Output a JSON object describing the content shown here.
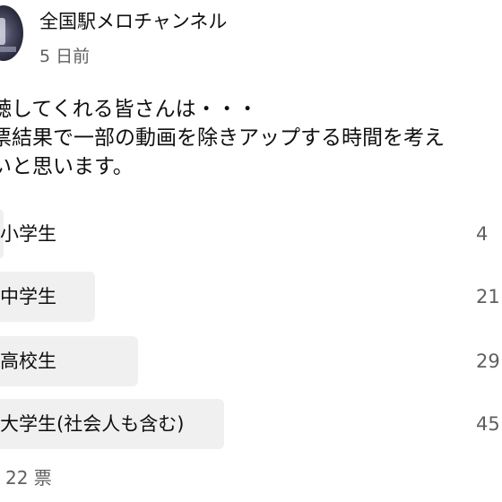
{
  "channel": {
    "name": "全国駅メロチャンネル",
    "timestamp": "5 日前"
  },
  "post": {
    "lines": [
      "聴してくれる皆さんは・・・",
      "票結果で一部の動画を除きアップする時間を考え",
      "いと思います。"
    ]
  },
  "poll": {
    "options": [
      {
        "label": "小学生",
        "percent_text": "4",
        "percent": 4
      },
      {
        "label": "中学生",
        "percent_text": "21",
        "percent": 21
      },
      {
        "label": "高校生",
        "percent_text": "29",
        "percent": 29
      },
      {
        "label": "大学生(社会人も含む)",
        "percent_text": "45",
        "percent": 45
      }
    ],
    "votes": "22 票"
  },
  "colors": {
    "text": "#0f0f0f",
    "secondary_text": "#606060",
    "poll_fill": "#f0f0f0",
    "background": "#ffffff"
  }
}
